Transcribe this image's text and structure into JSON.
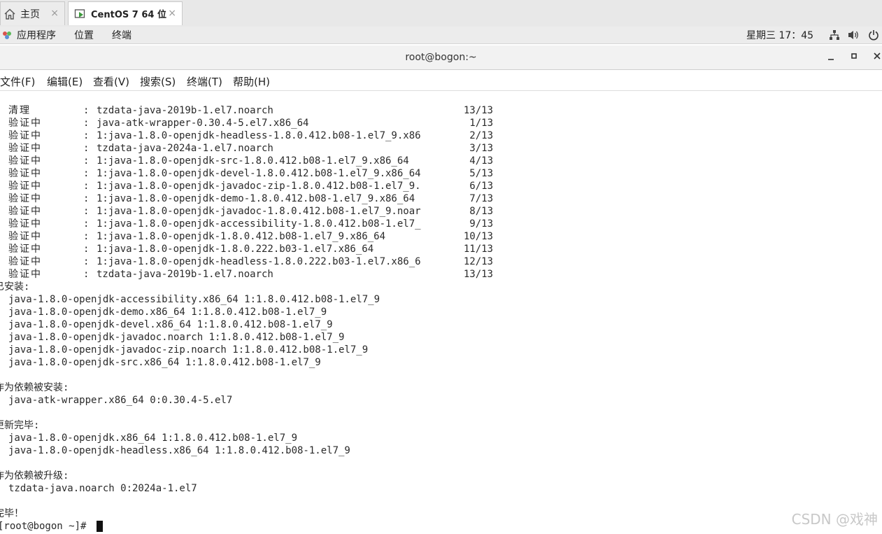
{
  "vm_tabs": [
    {
      "label": "主页",
      "icon": "home-icon",
      "close": "×"
    },
    {
      "label": "CentOS 7 64 位",
      "icon": "vm-icon",
      "close": "×"
    }
  ],
  "panel": {
    "apps": "应用程序",
    "places": "位置",
    "terminal": "终端",
    "clock": "星期三 17：45"
  },
  "window": {
    "title": "root@bogon:~"
  },
  "menu": [
    "文件(F)",
    "编辑(E)",
    "查看(V)",
    "搜索(S)",
    "终端(T)",
    "帮助(H)"
  ],
  "verify_rows": [
    {
      "label": "清理",
      "pkg": "tzdata-java-2019b-1.el7.noarch",
      "count": "13/13"
    },
    {
      "label": "验证中",
      "pkg": "java-atk-wrapper-0.30.4-5.el7.x86_64",
      "count": "1/13"
    },
    {
      "label": "验证中",
      "pkg": "1:java-1.8.0-openjdk-headless-1.8.0.412.b08-1.el7_9.x86",
      "count": "2/13"
    },
    {
      "label": "验证中",
      "pkg": "tzdata-java-2024a-1.el7.noarch",
      "count": "3/13"
    },
    {
      "label": "验证中",
      "pkg": "1:java-1.8.0-openjdk-src-1.8.0.412.b08-1.el7_9.x86_64",
      "count": "4/13"
    },
    {
      "label": "验证中",
      "pkg": "1:java-1.8.0-openjdk-devel-1.8.0.412.b08-1.el7_9.x86_64",
      "count": "5/13"
    },
    {
      "label": "验证中",
      "pkg": "1:java-1.8.0-openjdk-javadoc-zip-1.8.0.412.b08-1.el7_9.",
      "count": "6/13"
    },
    {
      "label": "验证中",
      "pkg": "1:java-1.8.0-openjdk-demo-1.8.0.412.b08-1.el7_9.x86_64",
      "count": "7/13"
    },
    {
      "label": "验证中",
      "pkg": "1:java-1.8.0-openjdk-javadoc-1.8.0.412.b08-1.el7_9.noar",
      "count": "8/13"
    },
    {
      "label": "验证中",
      "pkg": "1:java-1.8.0-openjdk-accessibility-1.8.0.412.b08-1.el7_",
      "count": "9/13"
    },
    {
      "label": "验证中",
      "pkg": "1:java-1.8.0-openjdk-1.8.0.412.b08-1.el7_9.x86_64",
      "count": "10/13"
    },
    {
      "label": "验证中",
      "pkg": "1:java-1.8.0-openjdk-1.8.0.222.b03-1.el7.x86_64",
      "count": "11/13"
    },
    {
      "label": "验证中",
      "pkg": "1:java-1.8.0-openjdk-headless-1.8.0.222.b03-1.el7.x86_6",
      "count": "12/13"
    },
    {
      "label": "验证中",
      "pkg": "tzdata-java-2019b-1.el7.noarch",
      "count": "13/13"
    }
  ],
  "sections": [
    {
      "heading": "已安装:",
      "items": [
        "java-1.8.0-openjdk-accessibility.x86_64 1:1.8.0.412.b08-1.el7_9",
        "java-1.8.0-openjdk-demo.x86_64 1:1.8.0.412.b08-1.el7_9",
        "java-1.8.0-openjdk-devel.x86_64 1:1.8.0.412.b08-1.el7_9",
        "java-1.8.0-openjdk-javadoc.noarch 1:1.8.0.412.b08-1.el7_9",
        "java-1.8.0-openjdk-javadoc-zip.noarch 1:1.8.0.412.b08-1.el7_9",
        "java-1.8.0-openjdk-src.x86_64 1:1.8.0.412.b08-1.el7_9"
      ]
    },
    {
      "heading": "作为依赖被安装:",
      "items": [
        "java-atk-wrapper.x86_64 0:0.30.4-5.el7"
      ]
    },
    {
      "heading": "更新完毕:",
      "items": [
        "java-1.8.0-openjdk.x86_64 1:1.8.0.412.b08-1.el7_9",
        "java-1.8.0-openjdk-headless.x86_64 1:1.8.0.412.b08-1.el7_9"
      ]
    },
    {
      "heading": "作为依赖被升级:",
      "items": [
        "tzdata-java.noarch 0:2024a-1.el7"
      ]
    }
  ],
  "done": "完毕！",
  "prompt": "[root@bogon ~]# ",
  "watermark": "CSDN @戏神"
}
